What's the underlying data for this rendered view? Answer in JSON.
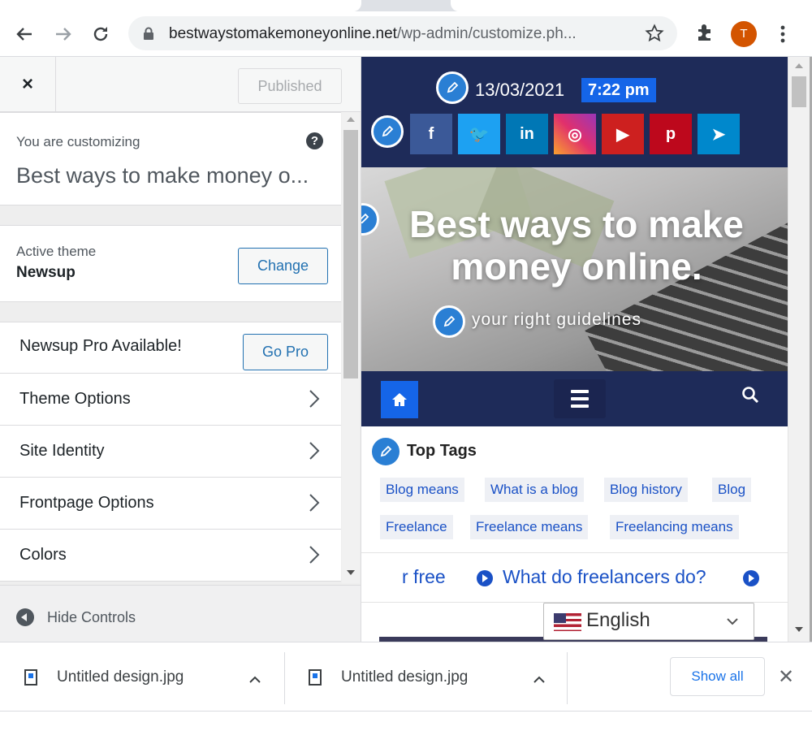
{
  "browser": {
    "url_host": "bestwaystomakemoneyonline.net",
    "url_path": "/wp-admin/customize.ph...",
    "profile_initial": "T",
    "icons": [
      "back-arrow-icon",
      "forward-arrow-icon",
      "reload-icon",
      "lock-icon",
      "bookmark-star-icon",
      "extensions-puzzle-icon",
      "more-vertical-icon"
    ]
  },
  "customizer": {
    "close_label": "×",
    "published_label": "Published",
    "info_label": "You are customizing",
    "site_title": "Best ways to make money o...",
    "help_label": "?",
    "active_theme_label": "Active theme",
    "active_theme_name": "Newsup",
    "change_label": "Change",
    "pro_label": "Newsup Pro Available!",
    "gopro_label": "Go Pro",
    "menu": [
      {
        "label": "Theme Options"
      },
      {
        "label": "Site Identity"
      },
      {
        "label": "Frontpage Options"
      },
      {
        "label": "Colors"
      }
    ],
    "hide_controls_label": "Hide Controls"
  },
  "preview": {
    "date": "13/03/2021",
    "time": "7:22 pm",
    "social": [
      {
        "icon": "facebook-icon",
        "glyph": "f",
        "color": "#3b5998"
      },
      {
        "icon": "twitter-icon",
        "glyph": "🐦",
        "color": "#1da1f2"
      },
      {
        "icon": "linkedin-icon",
        "glyph": "in",
        "color": "#0077b5"
      },
      {
        "icon": "instagram-icon",
        "glyph": "◎",
        "color": "#e1306c"
      },
      {
        "icon": "youtube-icon",
        "glyph": "▶",
        "color": "#cd201f"
      },
      {
        "icon": "pinterest-icon",
        "glyph": "p",
        "color": "#bd081c"
      },
      {
        "icon": "telegram-icon",
        "glyph": "➤",
        "color": "#0088cc"
      }
    ],
    "hero_title": "Best ways to make money online.",
    "hero_tagline": "your right guidelines",
    "tags_heading": "Top Tags",
    "tags": [
      "Blog means",
      "What is a blog",
      "Blog history",
      "Blog",
      "Freelance",
      "Freelance means",
      "Freelancing means"
    ],
    "ticker": [
      "r free",
      "What do freelancers do?"
    ],
    "language": "English",
    "colors": {
      "header_bg": "#1e2b59",
      "accent": "#1565e8",
      "tag_text": "#1a51c6"
    }
  },
  "downloads": {
    "items": [
      {
        "name": "Untitled design.jpg"
      },
      {
        "name": "Untitled design.jpg"
      }
    ],
    "show_all_label": "Show all",
    "close_label": "✕"
  }
}
